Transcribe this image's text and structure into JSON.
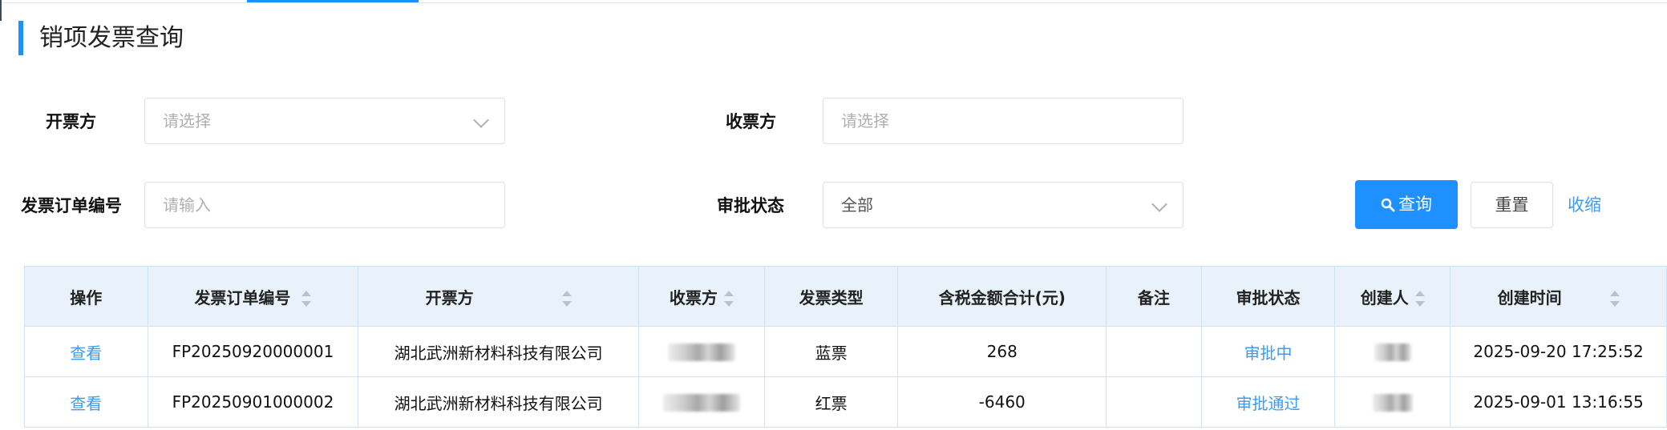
{
  "page": {
    "title": "销项发票查询"
  },
  "filters": {
    "issuer": {
      "label": "开票方",
      "placeholder": "请选择"
    },
    "receiver": {
      "label": "收票方",
      "placeholder": "请选择"
    },
    "order_no": {
      "label": "发票订单编号",
      "placeholder": "请输入"
    },
    "approval_status": {
      "label": "审批状态",
      "value": "全部"
    }
  },
  "actions": {
    "query": "查询",
    "reset": "重置",
    "collapse": "收缩"
  },
  "table": {
    "columns": [
      "操作",
      "发票订单编号",
      "开票方",
      "收票方",
      "发票类型",
      "含税金额合计(元)",
      "备注",
      "审批状态",
      "创建人",
      "创建时间"
    ],
    "rows": [
      {
        "action": "查看",
        "order_no": "FP20250920000001",
        "issuer": "湖北武洲新材料科技有限公司",
        "invoice_type": "蓝票",
        "amount": "268",
        "remark": "",
        "status": "审批中",
        "created_at": "2025-09-20 17:25:52"
      },
      {
        "action": "查看",
        "order_no": "FP20250901000002",
        "issuer": "湖北武洲新材料科技有限公司",
        "invoice_type": "红票",
        "amount": "-6460",
        "remark": "",
        "status": "审批通过",
        "created_at": "2025-09-01 13:16:55"
      }
    ]
  },
  "colors": {
    "accent": "#1e90ff",
    "link": "#3c9bf0",
    "header_bg": "#e9f2fb",
    "border": "#cfe3f3"
  }
}
